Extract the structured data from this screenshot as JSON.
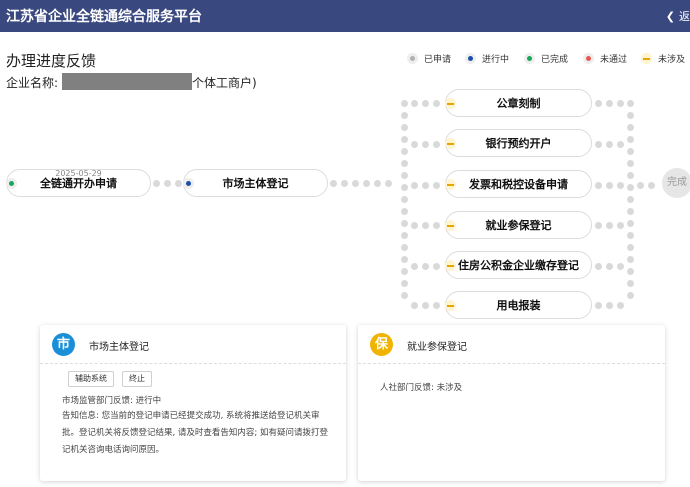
{
  "header": {
    "title": "江苏省企业全链通综合服务平台",
    "back_label": "返"
  },
  "page": {
    "title": "办理进度反馈",
    "company_label": "企业名称:",
    "company_suffix": "个体工商户)"
  },
  "legend": [
    {
      "label": "已申请",
      "color": "#b0b0b0"
    },
    {
      "label": "进行中",
      "color": "#1e4fa8"
    },
    {
      "label": "已完成",
      "color": "#19a85a"
    },
    {
      "label": "未通过",
      "color": "#e85555"
    },
    {
      "label": "未涉及",
      "color": "#e6a600"
    }
  ],
  "flow": {
    "start": {
      "label": "全链通开办申请",
      "date": "2025-05-29",
      "status": "已完成"
    },
    "registration": {
      "label": "市场主体登记",
      "status": "进行中"
    },
    "branches": [
      {
        "label": "公章刻制",
        "status": "未涉及"
      },
      {
        "label": "银行预约开户",
        "status": "未涉及"
      },
      {
        "label": "发票和税控设备申请",
        "status": "未涉及"
      },
      {
        "label": "就业参保登记",
        "status": "未涉及"
      },
      {
        "label": "住房公积金企业缴存登记",
        "status": "未涉及"
      },
      {
        "label": "用电报装",
        "status": "未涉及"
      }
    ],
    "final_label": "完成"
  },
  "cards": [
    {
      "badge": "市",
      "badge_color": "#1a8fd8",
      "title": "市场主体登记",
      "buttons": [
        "辅助系统",
        "终止"
      ],
      "lines": [
        "市场监管部门反馈:  进行中",
        "告知信息:  您当前的登记申请已经提交成功, 系统将推送给登记机关审",
        "批。登记机关将反馈登记结果, 请及时查看告知内容; 如有疑问请拨打登",
        "记机关咨询电话询问原因。"
      ]
    },
    {
      "badge": "保",
      "badge_color": "#f0b400",
      "title": "就业参保登记",
      "lines": [
        "人社部门反馈:  未涉及"
      ]
    }
  ]
}
